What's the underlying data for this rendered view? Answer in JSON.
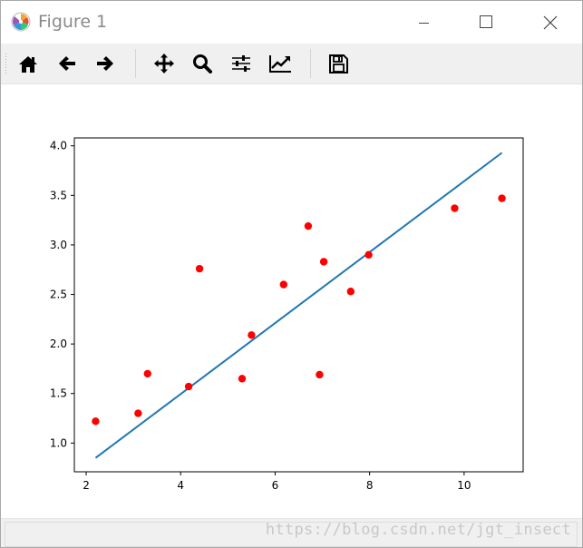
{
  "window": {
    "title": "Figure 1"
  },
  "toolbar": {
    "buttons": [
      {
        "name": "home",
        "icon": "home-icon"
      },
      {
        "name": "back",
        "icon": "arrow-left-icon"
      },
      {
        "name": "forward",
        "icon": "arrow-right-icon"
      },
      {
        "name": "pan",
        "icon": "move-icon"
      },
      {
        "name": "zoom",
        "icon": "magnifier-icon"
      },
      {
        "name": "configure-subplots",
        "icon": "sliders-icon"
      },
      {
        "name": "edit-axes",
        "icon": "line-chart-icon"
      },
      {
        "name": "save",
        "icon": "floppy-disk-icon"
      }
    ]
  },
  "watermark": "https://blog.csdn.net/jgt_insect",
  "colors": {
    "points": "#ff0000",
    "line": "#1f77b4",
    "toolbar_bg": "#f0f0f0"
  },
  "chart_data": {
    "type": "scatter",
    "title": "",
    "xlabel": "",
    "ylabel": "",
    "xlim": [
      1.75,
      11.25
    ],
    "ylim": [
      0.71,
      4.08
    ],
    "xticks": [
      2,
      4,
      6,
      8,
      10
    ],
    "yticks": [
      1.0,
      1.5,
      2.0,
      2.5,
      3.0,
      3.5,
      4.0
    ],
    "xtick_labels": [
      "2",
      "4",
      "6",
      "8",
      "10"
    ],
    "ytick_labels": [
      "1.0",
      "1.5",
      "2.0",
      "2.5",
      "3.0",
      "3.5",
      "4.0"
    ],
    "grid": false,
    "series": [
      {
        "type": "scatter",
        "color": "#ff0000",
        "x": [
          2.2,
          3.1,
          3.3,
          4.17,
          4.4,
          5.3,
          5.5,
          6.18,
          6.7,
          6.94,
          7.03,
          7.6,
          7.98,
          9.8,
          10.8
        ],
        "y": [
          1.22,
          1.3,
          1.7,
          1.57,
          2.76,
          1.65,
          2.09,
          2.6,
          3.19,
          1.69,
          2.83,
          2.53,
          2.9,
          3.37,
          3.47
        ]
      },
      {
        "type": "line",
        "color": "#1f77b4",
        "x": [
          2.2,
          10.8
        ],
        "y": [
          0.85,
          3.93
        ]
      }
    ]
  }
}
